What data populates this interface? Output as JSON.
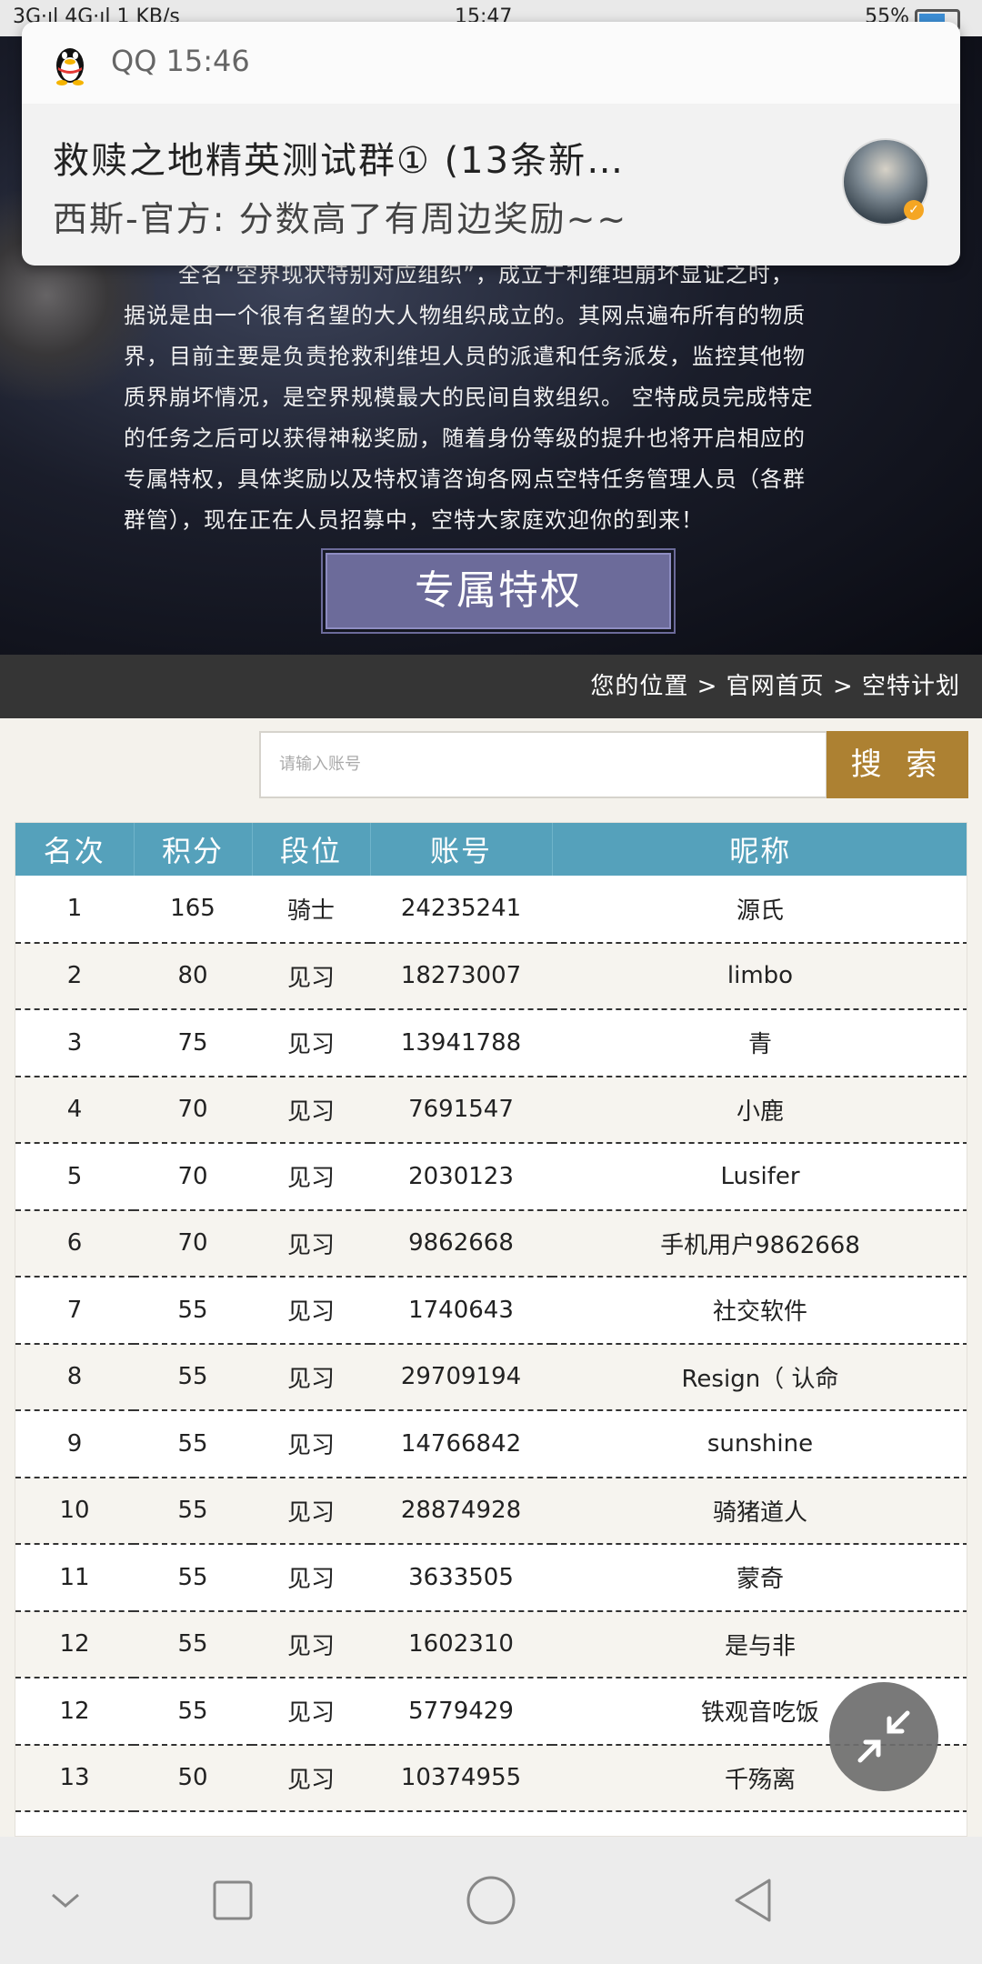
{
  "status_bar": {
    "left": "3G⋅ıl 4G⋅ıl 1 KB/s",
    "time": "15:47",
    "battery": "55%"
  },
  "notification": {
    "app": "QQ 15:46",
    "title": "救赎之地精英测试群① (13条新…",
    "message": "西斯-官方: 分数高了有周边奖励~~"
  },
  "hero": {
    "paragraph_lines": [
      "全名“空界现状特别对应组织”，成立于利维坦崩坏显证之时，",
      "据说是由一个很有名望的大人物组织成立的。其网点遍布所有的物质",
      "界，目前主要是负责抢救利维坦人员的派遣和任务派发，监控其他物",
      "质界崩坏情况，是空界规模最大的民间自救组织。 空特成员完成特定",
      "的任务之后可以获得神秘奖励，随着身份等级的提升也将开启相应的",
      "专属特权，具体奖励以及特权请咨询各网点空特任务管理人员（各群",
      "群管），现在正在人员招募中，空特大家庭欢迎你的到来！"
    ],
    "privilege_button": "专属特权"
  },
  "breadcrumb": "您的位置 > 官网首页 > 空特计划",
  "search": {
    "placeholder": "请输入账号",
    "button": "搜 索"
  },
  "table": {
    "headers": [
      "名次",
      "积分",
      "段位",
      "账号",
      "昵称"
    ],
    "rows": [
      [
        "1",
        "165",
        "骑士",
        "24235241",
        "源氏"
      ],
      [
        "2",
        "80",
        "见习",
        "18273007",
        "limbo"
      ],
      [
        "3",
        "75",
        "见习",
        "13941788",
        "青"
      ],
      [
        "4",
        "70",
        "见习",
        "7691547",
        "小鹿"
      ],
      [
        "5",
        "70",
        "见习",
        "2030123",
        "Lusifer"
      ],
      [
        "6",
        "70",
        "见习",
        "9862668",
        "手机用户9862668"
      ],
      [
        "7",
        "55",
        "见习",
        "1740643",
        "社交软件"
      ],
      [
        "8",
        "55",
        "见习",
        "29709194",
        "Resign（ 认命"
      ],
      [
        "9",
        "55",
        "见习",
        "14766842",
        "sunshine"
      ],
      [
        "10",
        "55",
        "见习",
        "28874928",
        "骑猪道人"
      ],
      [
        "11",
        "55",
        "见习",
        "3633505",
        "蒙奇"
      ],
      [
        "12",
        "55",
        "见习",
        "1602310",
        "是与非"
      ],
      [
        "12",
        "55",
        "见习",
        "5779429",
        "铁观音吃饭"
      ],
      [
        "13",
        "50",
        "见习",
        "10374955",
        "千殇离"
      ]
    ]
  },
  "colors": {
    "header_bg": "#55a1bb",
    "search_button": "#ad8132",
    "privilege_button": "#6c6b9a",
    "breadcrumb_bg": "#353535"
  },
  "icons": {
    "notification_app": "qq-penguin-icon",
    "float": "collapse-arrows-icon",
    "nav": [
      "nav-down-icon",
      "recent-apps-icon",
      "home-icon",
      "back-icon"
    ]
  }
}
